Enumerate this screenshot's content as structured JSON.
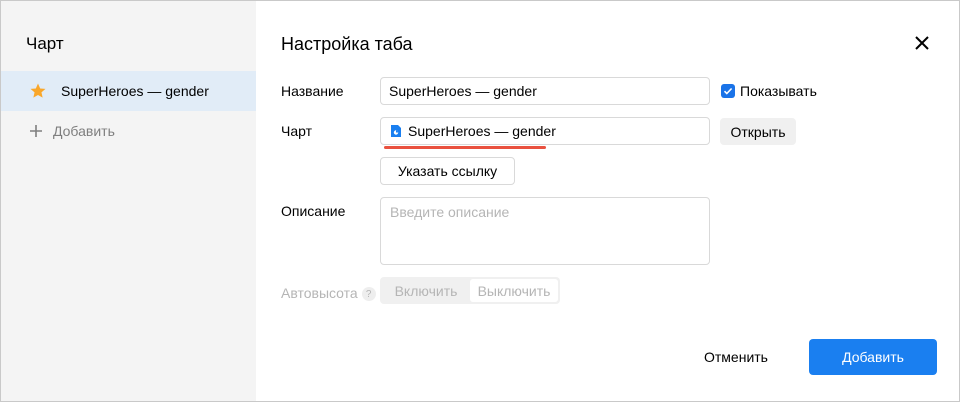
{
  "colors": {
    "accent": "#1a7ff0",
    "sidebar_bg": "#f4f4f4",
    "selected_bg": "#e1ecf7",
    "star": "#f9a72b",
    "highlight_underline": "#e9513f",
    "disabled_text": "#b5b5b5"
  },
  "sidebar": {
    "title": "Чарт",
    "items": [
      {
        "label": "SuperHeroes — gender",
        "icon": "star-icon",
        "selected": true
      }
    ],
    "add_label": "Добавить"
  },
  "dialog": {
    "title": "Настройка таба",
    "close_icon": "close-icon"
  },
  "form": {
    "name_label": "Название",
    "name_value": "SuperHeroes — gender",
    "show_checkbox_label": "Показывать",
    "show_checked": true,
    "chart_label": "Чарт",
    "chart_value": "SuperHeroes — gender",
    "chart_icon": "file-icon",
    "open_button": "Открыть",
    "link_button": "Указать ссылку",
    "description_label": "Описание",
    "description_placeholder": "Введите описание",
    "autoheight_label": "Автовысота",
    "autoheight_help": "?",
    "autoheight_options": [
      "Включить",
      "Выключить"
    ],
    "autoheight_selected": "Выключить"
  },
  "footer": {
    "cancel_label": "Отменить",
    "submit_label": "Добавить"
  }
}
